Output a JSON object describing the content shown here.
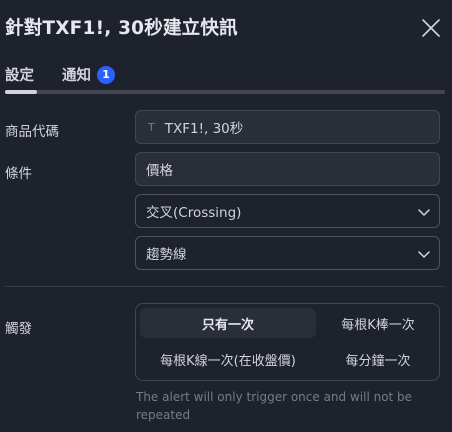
{
  "dialog": {
    "title": "針對TXF1!, 30秒建立快訊"
  },
  "tabs": {
    "settings": "設定",
    "notifications": "通知",
    "notifications_badge": "1"
  },
  "form": {
    "symbol_label": "商品代碼",
    "symbol_value": "TXF1!, 30秒",
    "symbol_icon_text": "T",
    "condition_label": "條件",
    "condition_value": "價格",
    "operator_value": "交叉(Crossing)",
    "target_value": "趨勢線",
    "trigger_label": "觸發",
    "trigger_options": {
      "once": "只有一次",
      "once_per_bar": "每根K棒一次",
      "once_per_bar_close": "每根K線一次(在收盤價)",
      "once_per_minute": "每分鐘一次"
    },
    "trigger_selected": "once",
    "hint": "The alert will only trigger once and will not be repeated"
  },
  "icons": {
    "close": "close-icon",
    "chevron": "chevron-down-icon"
  },
  "colors": {
    "background": "#1e222d",
    "accent": "#2962ff",
    "field_bg": "#2a2e39",
    "border": "#434651",
    "text": "#d1d4dc",
    "muted": "#787b86"
  }
}
